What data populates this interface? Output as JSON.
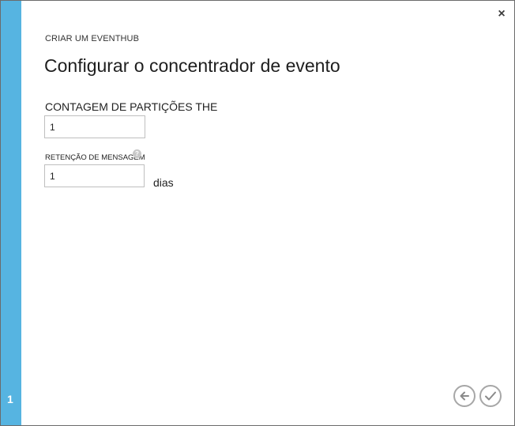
{
  "sidebar": {
    "step": "1",
    "accent_color": "#56b4e1"
  },
  "dialog": {
    "close_label": "×",
    "subtitle": "CRIAR UM EVENTHUB",
    "title": "Configurar o concentrador de evento"
  },
  "form": {
    "partitions_label": "CONTAGEM DE PARTIÇÕES THE",
    "partitions_value": "1",
    "retention_label": "RETENÇÃO DE MENSAGEM",
    "retention_value": "1",
    "retention_unit": "dias",
    "help_glyph": "?"
  },
  "footer": {
    "back_icon": "arrow-left-icon",
    "confirm_icon": "checkmark-icon"
  }
}
